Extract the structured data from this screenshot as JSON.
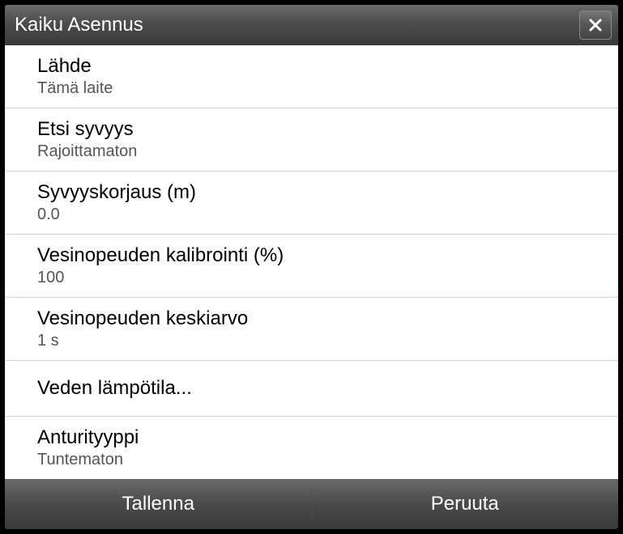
{
  "titlebar": {
    "title": "Kaiku Asennus"
  },
  "items": [
    {
      "label": "Lähde",
      "value": "Tämä laite"
    },
    {
      "label": "Etsi syvyys",
      "value": "Rajoittamaton"
    },
    {
      "label": "Syvyyskorjaus (m)",
      "value": "0.0"
    },
    {
      "label": "Vesinopeuden kalibrointi (%)",
      "value": "100"
    },
    {
      "label": "Vesinopeuden keskiarvo",
      "value": "1 s"
    },
    {
      "label": "Veden lämpötila...",
      "value": null
    },
    {
      "label": "Anturityyppi",
      "value": "Tuntematon"
    }
  ],
  "footer": {
    "save_label": "Tallenna",
    "cancel_label": "Peruuta"
  }
}
